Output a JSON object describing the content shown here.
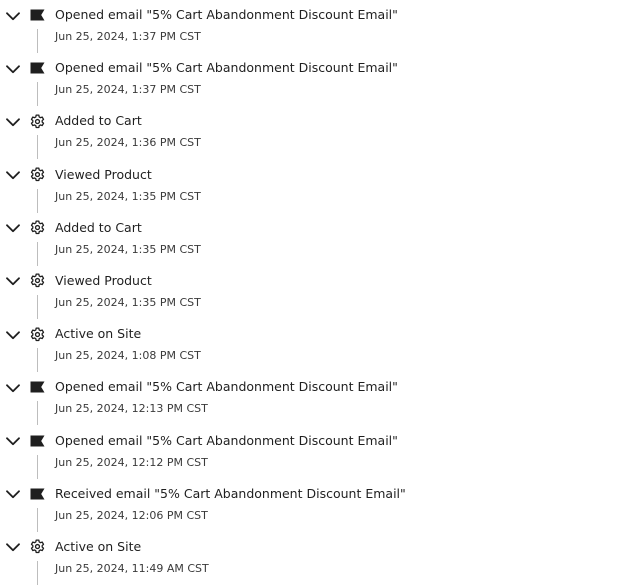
{
  "timeline": {
    "events": [
      {
        "kind": "email",
        "icon": "flag-icon",
        "title": "Opened email \"5% Cart Abandonment Discount Email\"",
        "timestamp": "Jun 25, 2024, 1:37 PM CST"
      },
      {
        "kind": "email",
        "icon": "flag-icon",
        "title": "Opened email \"5% Cart Abandonment Discount Email\"",
        "timestamp": "Jun 25, 2024, 1:37 PM CST"
      },
      {
        "kind": "site",
        "icon": "gear-icon",
        "title": "Added to Cart",
        "timestamp": "Jun 25, 2024, 1:36 PM CST"
      },
      {
        "kind": "site",
        "icon": "gear-icon",
        "title": "Viewed Product",
        "timestamp": "Jun 25, 2024, 1:35 PM CST"
      },
      {
        "kind": "site",
        "icon": "gear-icon",
        "title": "Added to Cart",
        "timestamp": "Jun 25, 2024, 1:35 PM CST"
      },
      {
        "kind": "site",
        "icon": "gear-icon",
        "title": "Viewed Product",
        "timestamp": "Jun 25, 2024, 1:35 PM CST"
      },
      {
        "kind": "site",
        "icon": "gear-icon",
        "title": "Active on Site",
        "timestamp": "Jun 25, 2024, 1:08 PM CST"
      },
      {
        "kind": "email",
        "icon": "flag-icon",
        "title": "Opened email \"5% Cart Abandonment Discount Email\"",
        "timestamp": "Jun 25, 2024, 12:13 PM CST"
      },
      {
        "kind": "email",
        "icon": "flag-icon",
        "title": "Opened email \"5% Cart Abandonment Discount Email\"",
        "timestamp": "Jun 25, 2024, 12:12 PM CST"
      },
      {
        "kind": "email",
        "icon": "flag-icon",
        "title": "Received email \"5% Cart Abandonment Discount Email\"",
        "timestamp": "Jun 25, 2024, 12:06 PM CST"
      },
      {
        "kind": "site",
        "icon": "gear-icon",
        "title": "Active on Site",
        "timestamp": "Jun 25, 2024, 11:49 AM CST"
      }
    ]
  },
  "colors": {
    "icon": "#1f1f1f",
    "rail": "#bdbdbd",
    "title_text": "#1f1f1f",
    "timestamp_text": "#3a3a3a"
  }
}
